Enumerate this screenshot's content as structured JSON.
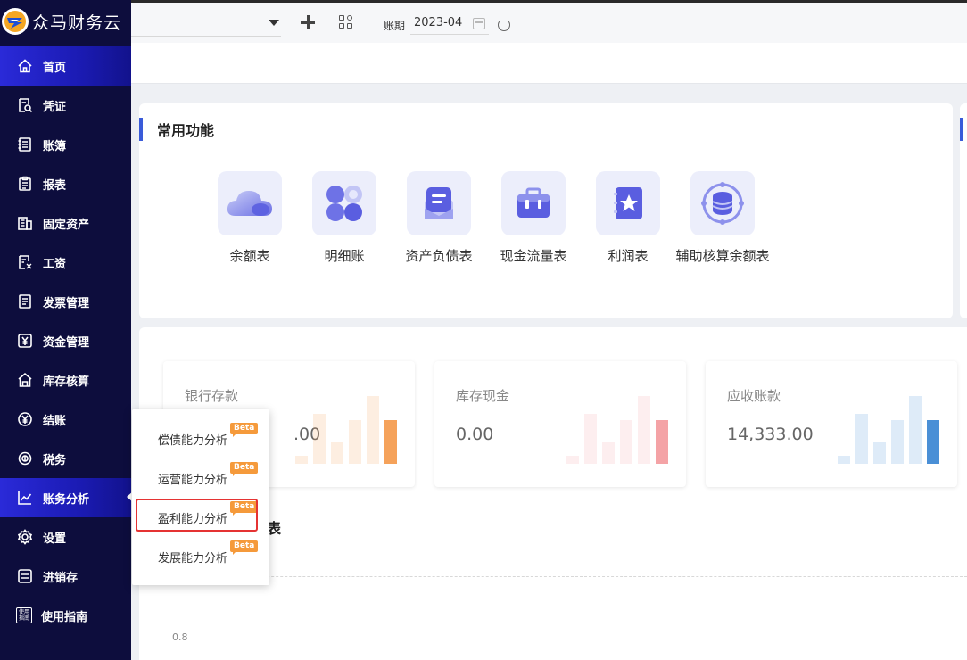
{
  "app": {
    "name": "众马财务云"
  },
  "sidebar": {
    "items": [
      {
        "label": "首页",
        "icon": "home-icon"
      },
      {
        "label": "凭证",
        "icon": "voucher-icon"
      },
      {
        "label": "账簿",
        "icon": "ledger-icon"
      },
      {
        "label": "报表",
        "icon": "report-icon"
      },
      {
        "label": "固定资产",
        "icon": "fixed-assets-icon"
      },
      {
        "label": "工资",
        "icon": "salary-icon"
      },
      {
        "label": "发票管理",
        "icon": "invoice-icon"
      },
      {
        "label": "资金管理",
        "icon": "funds-icon"
      },
      {
        "label": "库存核算",
        "icon": "inventory-icon"
      },
      {
        "label": "结账",
        "icon": "closing-icon"
      },
      {
        "label": "税务",
        "icon": "tax-icon"
      },
      {
        "label": "账务分析",
        "icon": "analysis-icon"
      },
      {
        "label": "设置",
        "icon": "settings-icon"
      },
      {
        "label": "进销存",
        "icon": "purchase-sales-icon"
      },
      {
        "label": "使用指南",
        "icon": "guide-icon"
      }
    ],
    "guide_icon_text": "使用指南",
    "active_index": 0,
    "hover_index": 11
  },
  "topbar": {
    "period_label": "账期",
    "period_value": "2023-04"
  },
  "common_functions": {
    "title": "常用功能",
    "items": [
      {
        "label": "余额表",
        "icon": "cloud-icon"
      },
      {
        "label": "明细账",
        "icon": "clover-icon"
      },
      {
        "label": "资产负债表",
        "icon": "document-tray-icon"
      },
      {
        "label": "现金流量表",
        "icon": "toolbox-icon"
      },
      {
        "label": "利润表",
        "icon": "star-notebook-icon"
      },
      {
        "label": "辅助核算余额表",
        "icon": "coin-stack-icon"
      }
    ]
  },
  "stats": [
    {
      "title": "银行存款",
      "value": ".00",
      "bars": [
        0.12,
        0.74,
        0.31,
        0.64,
        1.0,
        0.64
      ],
      "color": "#f5a25a"
    },
    {
      "title": "库存现金",
      "value": "0.00",
      "bars": [
        0.12,
        0.74,
        0.31,
        0.64,
        1.0,
        0.64
      ],
      "color": "#f4a3a6"
    },
    {
      "title": "应收账款",
      "value": "14,333.00",
      "bars": [
        0.12,
        0.74,
        0.31,
        0.64,
        1.0,
        0.64
      ],
      "color": "#4a8fd6"
    }
  ],
  "chart": {
    "section_title_tail": "表",
    "y_tick": "0.8"
  },
  "popover": {
    "items": [
      {
        "label": "偿债能力分析",
        "badge": "Beta"
      },
      {
        "label": "运营能力分析",
        "badge": "Beta"
      },
      {
        "label": "盈利能力分析",
        "badge": "Beta"
      },
      {
        "label": "发展能力分析",
        "badge": "Beta"
      }
    ],
    "highlighted_index": 2
  },
  "colors": {
    "sidebar_bg": "#0d0d3d",
    "active_item": "#2a2ad8",
    "accent": "#3a5bd9",
    "beta_badge": "#f59a3b",
    "highlight": "#e53333"
  }
}
